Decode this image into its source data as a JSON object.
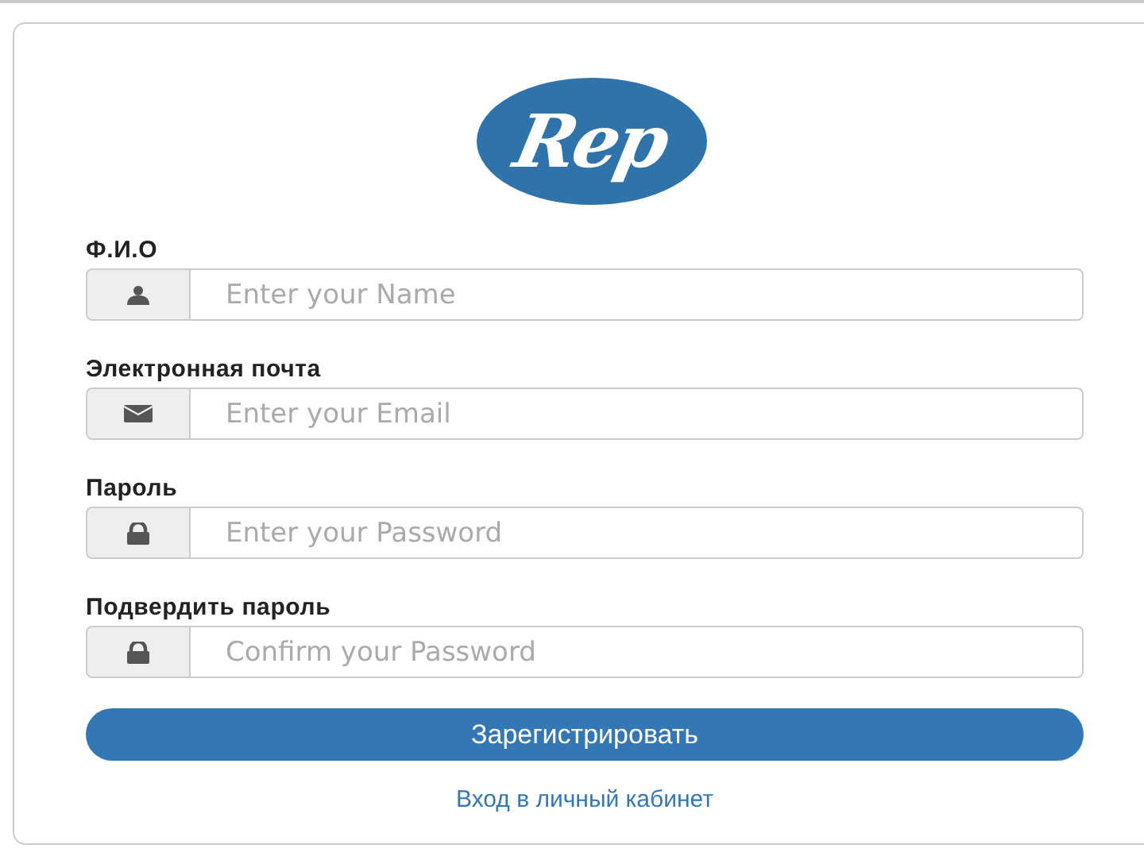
{
  "logo": {
    "text": "Rep"
  },
  "fields": [
    {
      "label": "Ф.И.О",
      "kind": "name",
      "placeholder": "Enter your Name"
    },
    {
      "label": "Электронная почта",
      "kind": "email",
      "placeholder": "Enter your Email"
    },
    {
      "label": "Пароль",
      "kind": "password",
      "placeholder": "Enter your Password"
    },
    {
      "label": "Подвердить пароль",
      "kind": "password",
      "placeholder": "Confirm your Password"
    }
  ],
  "submit_button": "Зарегистрировать",
  "login_link": "Вход в личный кабинет"
}
